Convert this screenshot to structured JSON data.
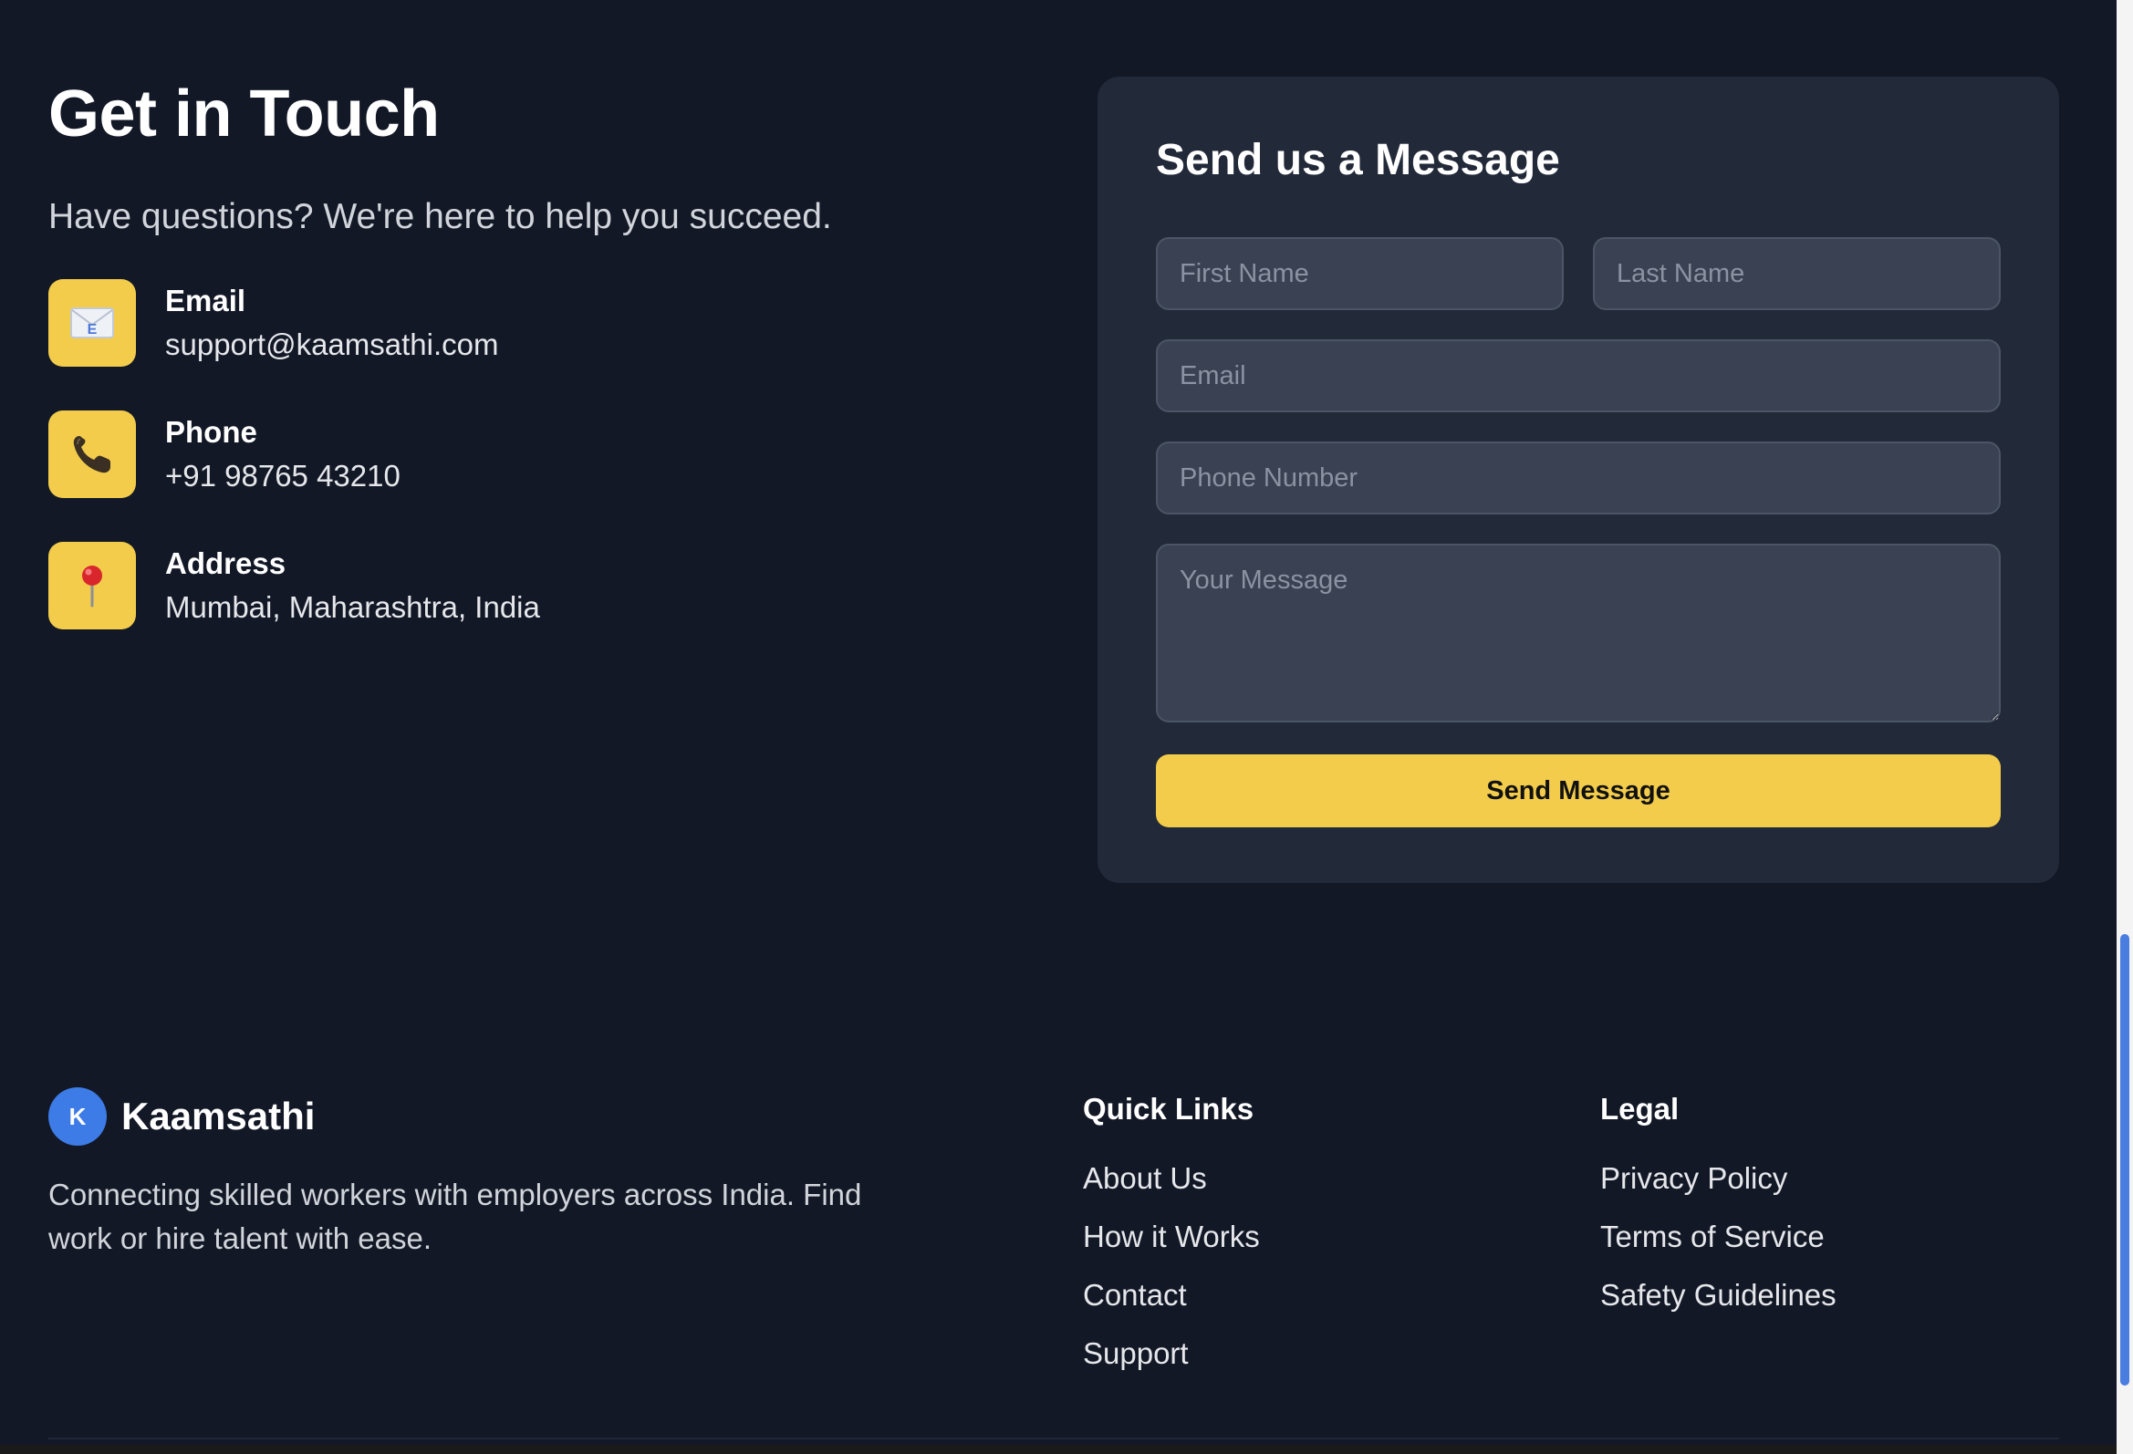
{
  "contact": {
    "title": "Get in Touch",
    "subtitle": "Have questions? We're here to help you succeed.",
    "items": [
      {
        "icon": "envelope-icon",
        "label": "Email",
        "value": "support@kaamsathi.com"
      },
      {
        "icon": "phone-icon",
        "label": "Phone",
        "value": "+91 98765 43210"
      },
      {
        "icon": "pin-icon",
        "label": "Address",
        "value": "Mumbai, Maharashtra, India"
      }
    ]
  },
  "form": {
    "title": "Send us a Message",
    "first_name_placeholder": "First Name",
    "last_name_placeholder": "Last Name",
    "email_placeholder": "Email",
    "phone_placeholder": "Phone Number",
    "message_placeholder": "Your Message",
    "submit_label": "Send Message"
  },
  "footer": {
    "brand": {
      "logo_letter": "K",
      "name": "Kaamsathi",
      "description": "Connecting skilled workers with employers across India. Find work or hire talent with ease."
    },
    "quick_links": {
      "heading": "Quick Links",
      "links": [
        "About Us",
        "How it Works",
        "Contact",
        "Support"
      ]
    },
    "legal": {
      "heading": "Legal",
      "links": [
        "Privacy Policy",
        "Terms of Service",
        "Safety Guidelines"
      ]
    }
  },
  "colors": {
    "background": "#131826",
    "card": "#222939",
    "accent": "#f2cc4a",
    "brand": "#3d7be6",
    "input": "#394152"
  }
}
